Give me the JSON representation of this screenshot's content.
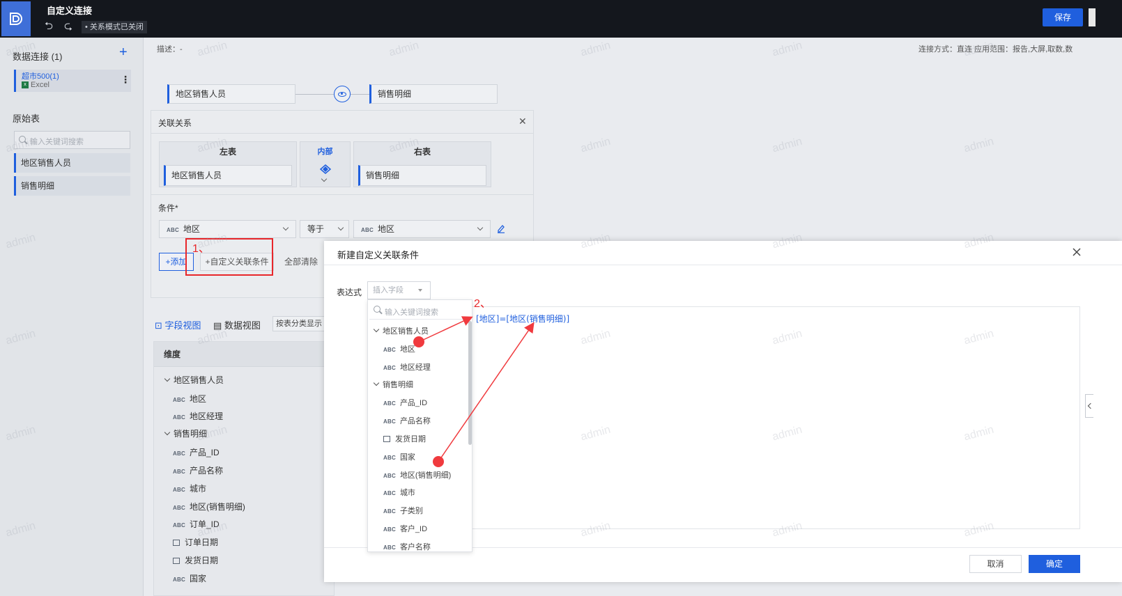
{
  "topbar": {
    "title": "自定义连接",
    "mode_chip": "• 关系模式已关闭",
    "save_label": "保存"
  },
  "sidebar": {
    "connections_title": "数据连接 (1)",
    "connection": {
      "name": "超市500(1)",
      "type": "Excel"
    },
    "raw_title": "原始表",
    "search_placeholder": "输入关键词搜索",
    "tables": [
      "地区销售人员",
      "销售明细"
    ]
  },
  "canvas": {
    "desc": "描述：-",
    "conn_info": "连接方式：直连    应用范围：报告,大屏,取数,数",
    "left_node": "地区销售人员",
    "right_node": "销售明细"
  },
  "relation": {
    "title": "关联关系",
    "left_header": "左表",
    "join_header": "内部",
    "right_header": "右表",
    "left_table": "地区销售人员",
    "right_table": "销售明细",
    "condition_label": "条件*",
    "cond_left": "地区",
    "cond_op": "等于",
    "cond_right": "地区",
    "add_label": "+添加",
    "custom_label": "+自定义关联条件",
    "clear_label": "全部清除"
  },
  "annotations": {
    "step1": "1、",
    "step2": "2、"
  },
  "view": {
    "field_view": "字段视图",
    "data_view": "数据视图",
    "classify": "按表分类显示",
    "dim_header": "维度",
    "groups": [
      {
        "name": "地区销售人员",
        "fields": [
          "地区",
          "地区经理"
        ]
      },
      {
        "name": "销售明细",
        "fields": [
          "产品_ID",
          "产品名称",
          "城市",
          "地区(销售明细)",
          "订单_ID",
          "订单日期",
          "发货日期",
          "国家"
        ]
      }
    ]
  },
  "modal": {
    "title": "新建自定义关联条件",
    "expr_label": "表达式",
    "insert_placeholder": "插入字段",
    "expression": "[地区]=[地区(销售明细)]",
    "cancel_label": "取消",
    "ok_label": "确定"
  },
  "dropdown": {
    "search_placeholder": "输入关键词搜索",
    "groups": [
      {
        "name": "地区销售人员",
        "fields": [
          "地区",
          "地区经理"
        ]
      },
      {
        "name": "销售明细",
        "fields": [
          "产品_ID",
          "产品名称",
          "发货日期",
          "国家",
          "地区(销售明细)",
          "城市",
          "子类别",
          "客户_ID",
          "客户名称"
        ]
      }
    ]
  },
  "field_type_abc": "ABC",
  "watermark": "admin",
  "colors": {
    "accent": "#1f5fde",
    "annotation": "#e8262a",
    "topbar": "#14171d"
  }
}
